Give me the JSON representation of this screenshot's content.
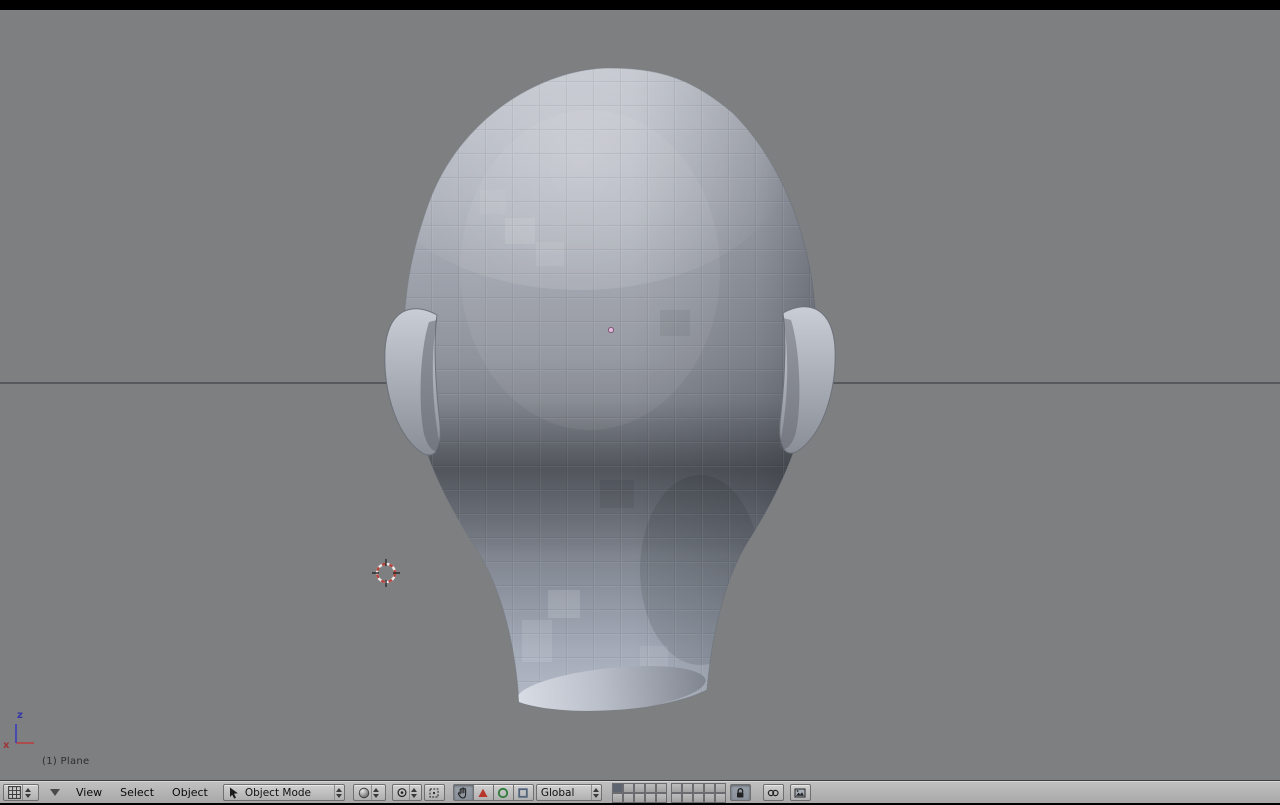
{
  "viewport": {
    "status_text": "(1) Plane",
    "axis_labels": {
      "x": "x",
      "z": "z"
    },
    "colors": {
      "background": "#7d7f80",
      "horizon_line": "#55585c",
      "head_base": "#9aa0aa",
      "cursor_ring_red": "#b5443c",
      "object_center_pink": "#e2b8dd"
    }
  },
  "header": {
    "menus": [
      "View",
      "Select",
      "Object"
    ],
    "mode": {
      "value": "Object Mode"
    },
    "orientation": {
      "value": "Global"
    },
    "manipulators": {
      "hand_pressed": true,
      "translate_pressed": false,
      "rotate_pressed": false,
      "scale_pressed": false,
      "translate_color": "#b8352c",
      "rotate_color": "#2f7d3a",
      "scale_color": "#51637c"
    },
    "lock": {
      "pressed": true
    },
    "layers": {
      "states": [
        true,
        false,
        false,
        false,
        false,
        false,
        false,
        false,
        false,
        false,
        false,
        false,
        false,
        false,
        false,
        false,
        false,
        false,
        false,
        false
      ]
    },
    "colors": {
      "bar": "#b4b4b4",
      "text": "#000000"
    }
  }
}
